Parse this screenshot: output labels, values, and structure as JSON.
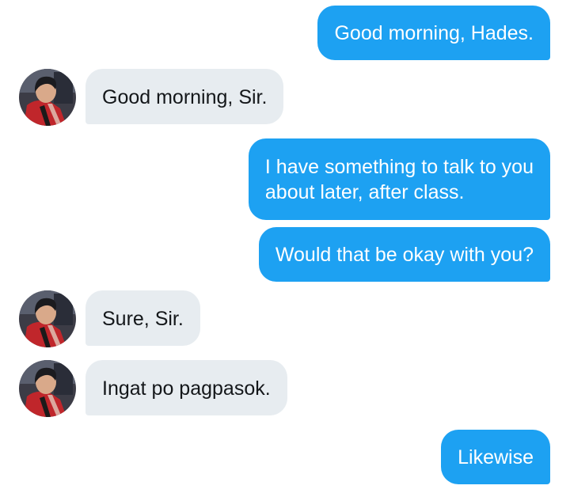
{
  "conversation": {
    "messages": [
      {
        "direction": "sent",
        "text": "Good morning, Hades."
      },
      {
        "direction": "received",
        "text": "Good morning, Sir."
      },
      {
        "direction": "sent",
        "text": "I have something to talk to you\nabout later, after class."
      },
      {
        "direction": "sent",
        "text": "Would that be okay with you?"
      },
      {
        "direction": "received",
        "text": "Sure, Sir."
      },
      {
        "direction": "received",
        "text": "Ingat po pagpasok."
      },
      {
        "direction": "sent",
        "text": "Likewise"
      }
    ]
  },
  "colors": {
    "sent_bubble": "#1da1f2",
    "received_bubble": "#e7ecf0",
    "sent_text": "#ffffff",
    "received_text": "#14171a"
  }
}
